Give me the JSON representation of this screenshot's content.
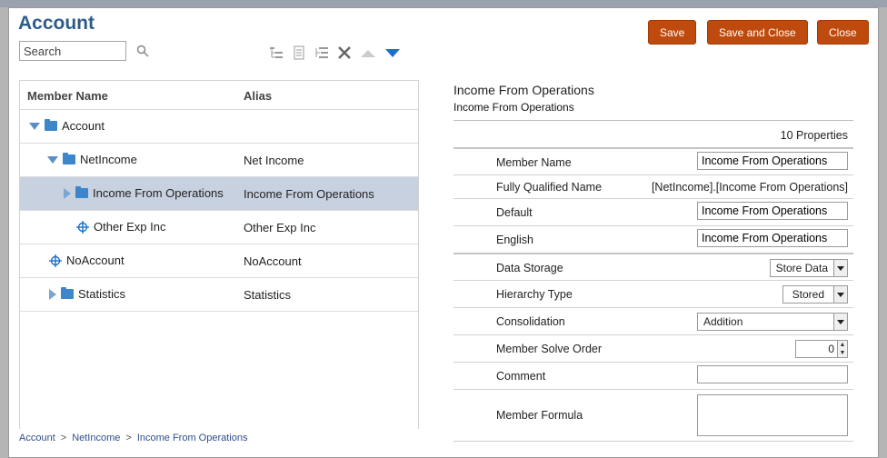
{
  "window": {
    "title": "Account"
  },
  "search": {
    "placeholder": "Search"
  },
  "toolbar": {
    "save": "Save",
    "save_and_close": "Save and Close",
    "close": "Close"
  },
  "tree": {
    "columns": {
      "member_name": "Member Name",
      "alias": "Alias"
    },
    "rows": [
      {
        "name": "Account",
        "alias": ""
      },
      {
        "name": "NetIncome",
        "alias": "Net Income"
      },
      {
        "name": "Income From Operations",
        "alias": "Income From Operations"
      },
      {
        "name": "Other Exp Inc",
        "alias": "Other Exp Inc"
      },
      {
        "name": "NoAccount",
        "alias": "NoAccount"
      },
      {
        "name": "Statistics",
        "alias": "Statistics"
      }
    ]
  },
  "breadcrumb": [
    "Account",
    "NetIncome",
    "Income From Operations"
  ],
  "properties": {
    "title": "Income From Operations",
    "subtitle": "Income From Operations",
    "count": "10 Properties",
    "member_name": {
      "label": "Member Name",
      "value": "Income From Operations"
    },
    "fully_qualified_name": {
      "label": "Fully Qualified Name",
      "value": "[NetIncome].[Income From Operations]"
    },
    "default": {
      "label": "Default",
      "value": "Income From Operations"
    },
    "english": {
      "label": "English",
      "value": "Income From Operations"
    },
    "data_storage": {
      "label": "Data Storage",
      "value": "Store Data"
    },
    "hierarchy_type": {
      "label": "Hierarchy Type",
      "value": "Stored"
    },
    "consolidation": {
      "label": "Consolidation",
      "value": "Addition"
    },
    "member_solve_order": {
      "label": "Member Solve Order",
      "value": "0"
    },
    "comment": {
      "label": "Comment",
      "value": ""
    },
    "member_formula": {
      "label": "Member Formula",
      "value": ""
    }
  },
  "colors": {
    "accent": "#bf4a0d",
    "title": "#2e5c8a",
    "selection": "#c8d1e0",
    "icon_blue": "#3c86c9"
  }
}
